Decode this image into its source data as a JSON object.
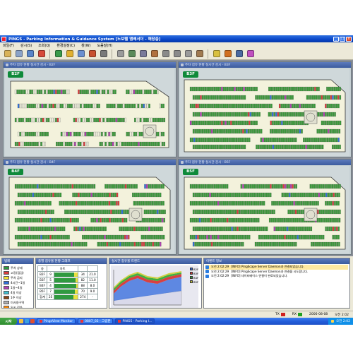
{
  "window": {
    "title": "PINGS - Parking Information & Guidance System [노보텔 앰배서더 - 매장층]",
    "buttons": [
      "_",
      "□",
      "x"
    ]
  },
  "menu": [
    "파일(F)",
    "감시(S)",
    "조회(Q)",
    "환경설정(C)",
    "창(W)",
    "도움말(H)"
  ],
  "toolbar_icons": [
    {
      "name": "open-icon",
      "color": "#d9b35a"
    },
    {
      "name": "save-icon",
      "color": "#8aa2c8"
    },
    {
      "name": "monitor-icon",
      "color": "#5a85c8"
    },
    {
      "name": "alarm-icon",
      "color": "#d64a3a"
    },
    {
      "name": "report-icon",
      "color": "#3a9a4a"
    },
    {
      "name": "edit-icon",
      "color": "#e0b030"
    },
    {
      "name": "search-icon",
      "color": "#6a8fd0"
    },
    {
      "name": "sign-icon",
      "color": "#c85030"
    },
    {
      "name": "car-icon",
      "color": "#7a7a7a"
    },
    {
      "name": "car-grey-icon",
      "color": "#9a9a9a"
    },
    {
      "name": "building-icon",
      "color": "#5a8a5a"
    },
    {
      "name": "camera-icon",
      "color": "#7a7a9a"
    },
    {
      "name": "gate-icon",
      "color": "#b07040"
    },
    {
      "name": "left-arrow-icon",
      "color": "#8a8a8a"
    },
    {
      "name": "right-arrow-icon",
      "color": "#8a8a8a"
    },
    {
      "name": "home-icon",
      "color": "#9a9a9a"
    },
    {
      "name": "tag-icon",
      "color": "#a07a50"
    },
    {
      "name": "light-icon",
      "color": "#d8c040"
    },
    {
      "name": "lock-icon",
      "color": "#d07020"
    },
    {
      "name": "display-icon",
      "color": "#4a6aa0"
    },
    {
      "name": "help-icon",
      "color": "#c050c0"
    }
  ],
  "floors": [
    {
      "label": "B2F",
      "title": "주차 점유 현황 실시간 감시 - B2F"
    },
    {
      "label": "B3F",
      "title": "주차 점유 현황 실시간 감시 - B3F"
    },
    {
      "label": "B4F",
      "title": "주차 점유 현황 실시간 감시 - B4F"
    },
    {
      "label": "B5F",
      "title": "주차 점유 현황 실시간 감시 - B5F"
    }
  ],
  "legend": {
    "title": "범례",
    "items": [
      {
        "label": "주차 상태",
        "color": "#2f9a3f"
      },
      {
        "label": "고장(점검)",
        "color": "#d83c3c"
      },
      {
        "label": "주차 금지",
        "color": "#f0e030"
      },
      {
        "label": "4시간~1일",
        "color": "#3070d8"
      },
      {
        "label": "1일~4일",
        "color": "#b040b0"
      },
      {
        "label": "4일 이상",
        "color": "#40c0d0"
      },
      {
        "label": "1주 이상",
        "color": "#8b4513"
      },
      {
        "label": "미사용구역",
        "color": "#b0b0b0"
      },
      {
        "label": "일시 정차",
        "color": "#ff8800"
      }
    ]
  },
  "occupancy": {
    "title": "층별 점유율 현황 그래프",
    "headers": [
      "층",
      "차트",
      "",
      ""
    ],
    "rows": [
      {
        "floor": "B2F",
        "count": "9",
        "used": "34",
        "rate": "21.0",
        "fill": 0.85
      },
      {
        "floor": "B3F",
        "count": "5",
        "used": "82",
        "rate": "11.0",
        "fill": 0.9
      },
      {
        "floor": "B4F",
        "count": "4",
        "used": "88",
        "rate": "8.0",
        "fill": 0.92
      },
      {
        "floor": "B5F",
        "count": "7",
        "used": "70",
        "rate": "9.0",
        "fill": 0.88
      },
      {
        "floor": "합계",
        "count": "25",
        "used": "274",
        "rate": "-",
        "fill": 0.8
      }
    ]
  },
  "trend": {
    "title": "실시간 점유율 트렌드",
    "series": [
      {
        "name": "B2F",
        "color": "#3060d0"
      },
      {
        "name": "B3F",
        "color": "#d03030"
      },
      {
        "name": "B4F",
        "color": "#30a030"
      },
      {
        "name": "B5F",
        "color": "#c0c030"
      }
    ]
  },
  "events": {
    "title": "이벤트 정보",
    "rows": [
      {
        "time": "오전 2:02:29",
        "text": "[INFO] PingScape Server Daemon과 연결되었습니다.",
        "selected": true
      },
      {
        "time": "오전 2:02:29",
        "text": "[INFO] PingScape Server Daemon과 연결을 시도합니다.",
        "selected": false
      },
      {
        "time": "오전 2:02:29",
        "text": "[INFO] 데이터베이스 연결이 완료되었습니다.",
        "selected": false
      }
    ]
  },
  "status": {
    "tx_label": "TX",
    "tx_color": "#d02020",
    "rx_label": "RX",
    "rx_color": "#20a020",
    "date": "2006-08-08",
    "time": "오전 2:02"
  },
  "taskbar": {
    "start": "시작",
    "quick_colors": [
      "#f0c040",
      "#3aa0e0",
      "#e05030"
    ],
    "tasks": [
      {
        "label": "PingsView Monitor",
        "active": false
      },
      {
        "label": "0807_02 - 그림판",
        "active": false
      },
      {
        "label": "PINGS - Parking I...",
        "active": true
      }
    ],
    "clock": "오전 2:02"
  }
}
